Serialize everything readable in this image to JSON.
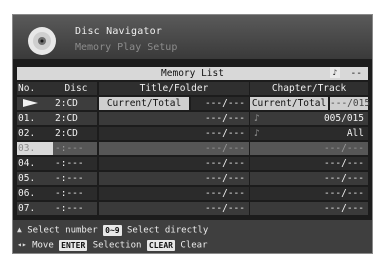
{
  "header": {
    "title": "Disc Navigator",
    "subtitle": "Memory Play Setup"
  },
  "table": {
    "section_title": "Memory List",
    "section_counter": "--",
    "columns": {
      "no": "No.",
      "disc": "Disc",
      "title": "Title/Folder",
      "chapter": "Chapter/Track"
    },
    "current_row": {
      "disc": "2:CD",
      "title_label": "Current/Total",
      "title_value": "---/---",
      "chapter_label": "Current/Total",
      "chapter_value": "---/015"
    },
    "rows": [
      {
        "no": "01.",
        "disc": "2:CD",
        "title": "---/---",
        "note": "♪",
        "chapter": "005/015"
      },
      {
        "no": "02.",
        "disc": "2:CD",
        "title": "---/---",
        "note": "♪",
        "chapter": "All"
      },
      {
        "no": "03.",
        "disc": "-:---",
        "title": "---/---",
        "note": "",
        "chapter": "---/---"
      },
      {
        "no": "04.",
        "disc": "-:---",
        "title": "---/---",
        "note": "",
        "chapter": "---/---"
      },
      {
        "no": "05.",
        "disc": "-:---",
        "title": "---/---",
        "note": "",
        "chapter": "---/---"
      },
      {
        "no": "06.",
        "disc": "-:---",
        "title": "---/---",
        "note": "",
        "chapter": "---/---"
      },
      {
        "no": "07.",
        "disc": "-:---",
        "title": "---/---",
        "note": "",
        "chapter": "---/---"
      }
    ],
    "selected_index": 2
  },
  "footer": {
    "line1_text1": "Select number",
    "line1_key": "0~9",
    "line1_text2": "Select directly",
    "line2_text1": "Move",
    "line2_key1": "ENTER",
    "line2_text2": "Selection",
    "line2_key2": "CLEAR",
    "line2_text3": "Clear"
  }
}
